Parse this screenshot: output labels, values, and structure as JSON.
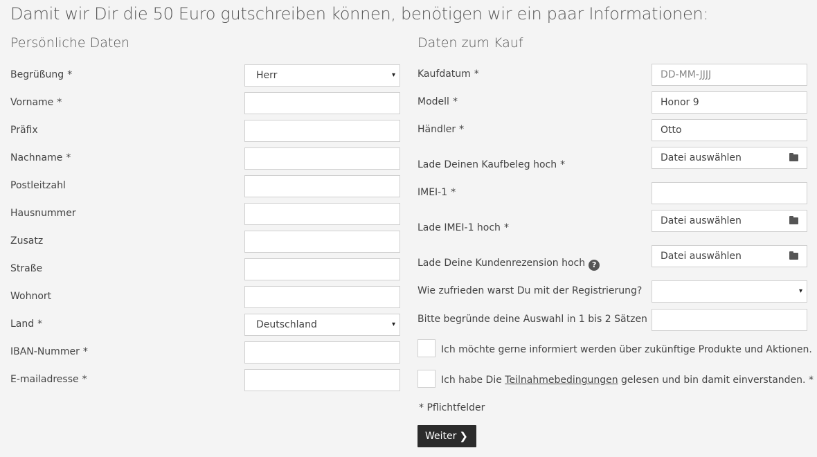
{
  "heading": "Damit wir Dir die 50 Euro gutschreiben können, benötigen wir ein paar Informationen:",
  "required_mark": "*",
  "personal": {
    "title": "Persönliche Daten",
    "fields": [
      {
        "label": "Begrüßung",
        "required": true,
        "type": "select",
        "value": "Herr"
      },
      {
        "label": "Vorname",
        "required": true,
        "type": "text",
        "value": ""
      },
      {
        "label": "Präfix",
        "required": false,
        "type": "text",
        "value": ""
      },
      {
        "label": "Nachname",
        "required": true,
        "type": "text",
        "value": ""
      },
      {
        "label": "Postleitzahl",
        "required": false,
        "type": "text",
        "value": ""
      },
      {
        "label": "Hausnummer",
        "required": false,
        "type": "text",
        "value": ""
      },
      {
        "label": "Zusatz",
        "required": false,
        "type": "text",
        "value": ""
      },
      {
        "label": "Straße",
        "required": false,
        "type": "text",
        "value": ""
      },
      {
        "label": "Wohnort",
        "required": false,
        "type": "text",
        "value": ""
      },
      {
        "label": "Land",
        "required": true,
        "type": "select",
        "value": "Deutschland"
      },
      {
        "label": "IBAN-Nummer",
        "required": true,
        "type": "text",
        "value": ""
      },
      {
        "label": "E-mailadresse",
        "required": true,
        "type": "text",
        "value": ""
      }
    ]
  },
  "purchase": {
    "title": "Daten zum Kauf",
    "kaufdatum": {
      "label": "Kaufdatum",
      "placeholder": "DD-MM-JJJJ"
    },
    "modell": {
      "label": "Modell",
      "value": "Honor 9"
    },
    "haendler": {
      "label": "Händler",
      "value": "Otto"
    },
    "kaufbeleg": {
      "label": "Lade Deinen Kaufbeleg hoch",
      "button": "Datei auswählen"
    },
    "imei": {
      "label": "IMEI-1",
      "value": ""
    },
    "imei_upload": {
      "label": "Lade IMEI-1 hoch",
      "button": "Datei auswählen"
    },
    "rezension": {
      "label": "Lade Deine Kundenrezension hoch",
      "button": "Datei auswählen",
      "help": "?"
    },
    "zufrieden": {
      "label": "Wie zufrieden warst Du mit der Registrierung?",
      "value": ""
    },
    "begruendung": {
      "label": "Bitte begründe deine Auswahl in 1 bis 2 Sätzen",
      "value": ""
    },
    "newsletter": {
      "label": "Ich möchte gerne informiert werden über zukünftige Produkte und Aktionen.",
      "checked": false
    },
    "terms": {
      "prefix": "Ich habe Die ",
      "link": "Teilnahmebedingungen",
      "suffix": " gelesen und bin damit einverstanden.",
      "checked": false
    },
    "required_note": "Pflichtfelder",
    "submit": "Weiter"
  },
  "icons": {
    "caret": "▾",
    "chevron": "❯",
    "folder": "folder-icon",
    "help": "help-circle-icon"
  }
}
